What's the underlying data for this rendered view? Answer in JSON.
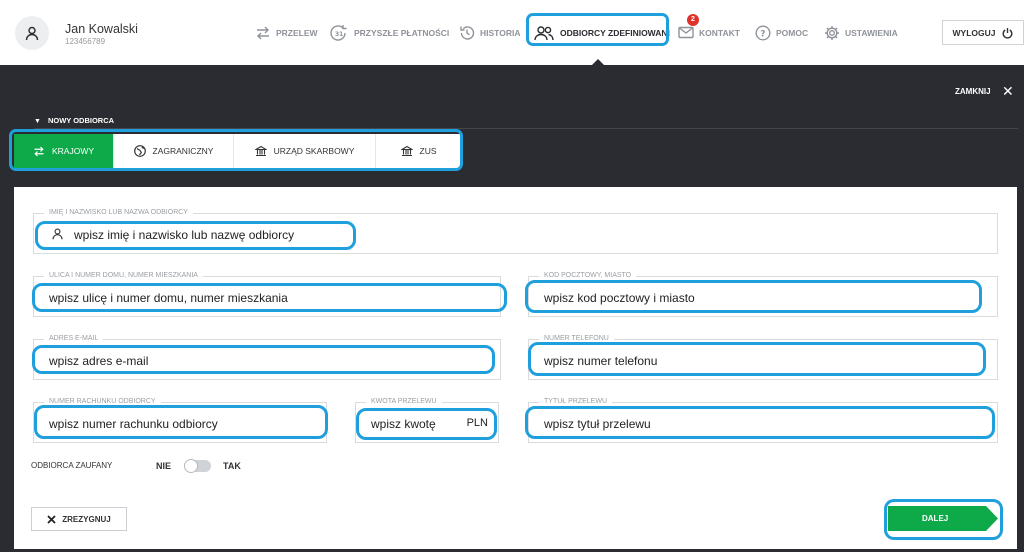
{
  "user": {
    "name": "Jan Kowalski",
    "id": "123456789"
  },
  "nav": {
    "przelew": "PRZELEW",
    "przyszle": "PRZYSZŁE PŁATNOŚCI",
    "historia": "HISTORIA",
    "odbiorcy": "ODBIORCY ZDEFINIOWANI",
    "kontakt": "KONTAKT",
    "kontakt_badge": "2",
    "pomoc": "POMOC",
    "ustawienia": "USTAWIENIA",
    "wyloguj": "WYLOGUJ"
  },
  "panel": {
    "close_label": "ZAMKNIJ",
    "close_icon": "✕",
    "section_title": "NOWY ODBIORCA"
  },
  "tabs": [
    {
      "label": "KRAJOWY",
      "icon": "arrows-exchange-icon",
      "active": true
    },
    {
      "label": "ZAGRANICZNY",
      "icon": "globe-icon",
      "active": false
    },
    {
      "label": "URZĄD SKARBOWY",
      "icon": "bank-icon",
      "active": false
    },
    {
      "label": "ZUS",
      "icon": "bank-icon",
      "active": false
    }
  ],
  "form": {
    "name": {
      "label": "IMIĘ I NAZWISKO LUB NAZWA ODBIORCY",
      "value": "wpisz imię i nazwisko lub nazwę odbiorcy"
    },
    "street": {
      "label": "ULICA I NUMER DOMU, NUMER MIESZKANIA",
      "value": "wpisz ulicę i numer domu, numer mieszkania"
    },
    "postal": {
      "label": "KOD POCZTOWY, MIASTO",
      "value": "wpisz kod pocztowy i miasto"
    },
    "email": {
      "label": "ADRES E-MAIL",
      "value": "wpisz adres e-mail"
    },
    "phone": {
      "label": "NUMER TELEFONU",
      "value": "wpisz numer telefonu"
    },
    "account": {
      "label": "NUMER RACHUNKU ODBIORCY",
      "value": "wpisz numer rachunku odbiorcy"
    },
    "amount": {
      "label": "KWOTA PRZELEWU",
      "value": "wpisz kwotę",
      "currency": "PLN"
    },
    "title": {
      "label": "TYTUŁ PRZELEWU",
      "value": "wpisz tytuł przelewu"
    },
    "trusted": {
      "label": "ODBIORCA ZAUFANY",
      "off": "NIE",
      "on": "TAK",
      "value": "NIE"
    },
    "cancel": "ZREZYGNUJ",
    "next": "DALEJ"
  },
  "colors": {
    "accent_green": "#0eaa4a",
    "highlight_blue": "#1fa0dd",
    "dark_bg": "#2b2c31",
    "badge_red": "#e0312c"
  }
}
